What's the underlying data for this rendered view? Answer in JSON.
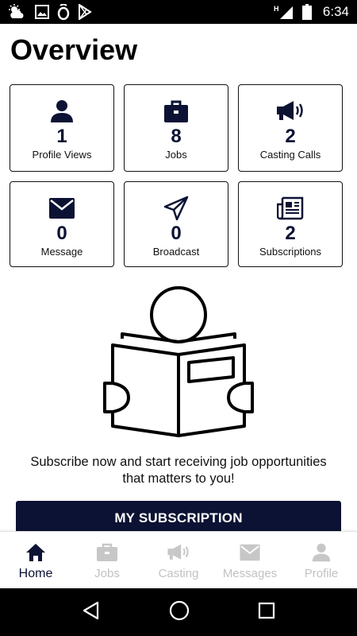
{
  "status_bar": {
    "time": "6:34",
    "network_type": "H",
    "icons": [
      "weather-icon",
      "image-icon",
      "app-o-icon",
      "play-store-icon",
      "signal-icon",
      "battery-icon"
    ]
  },
  "page": {
    "title": "Overview"
  },
  "stats": [
    {
      "icon": "person-icon",
      "value": "1",
      "label": "Profile Views"
    },
    {
      "icon": "briefcase-icon",
      "value": "8",
      "label": "Jobs"
    },
    {
      "icon": "megaphone-icon",
      "value": "2",
      "label": "Casting Calls"
    },
    {
      "icon": "envelope-icon",
      "value": "0",
      "label": "Message"
    },
    {
      "icon": "paper-plane-icon",
      "value": "0",
      "label": "Broadcast"
    },
    {
      "icon": "newspaper-icon",
      "value": "2",
      "label": "Subscriptions"
    }
  ],
  "promo": {
    "line1": "Subscribe now and start receiving job opportunities",
    "line2": "that matters to you!",
    "button_label": "MY SUBSCRIPTION"
  },
  "bottom_nav": {
    "items": [
      {
        "label": "Home",
        "icon": "home-icon",
        "active": true
      },
      {
        "label": "Jobs",
        "icon": "briefcase-icon",
        "active": false
      },
      {
        "label": "Casting",
        "icon": "megaphone-icon",
        "active": false
      },
      {
        "label": "Messages",
        "icon": "envelope-icon",
        "active": false
      },
      {
        "label": "Profile",
        "icon": "person-icon",
        "active": false
      }
    ]
  },
  "colors": {
    "primary": "#0b1233",
    "inactive": "#c2c2c2",
    "background": "#ffffff"
  }
}
